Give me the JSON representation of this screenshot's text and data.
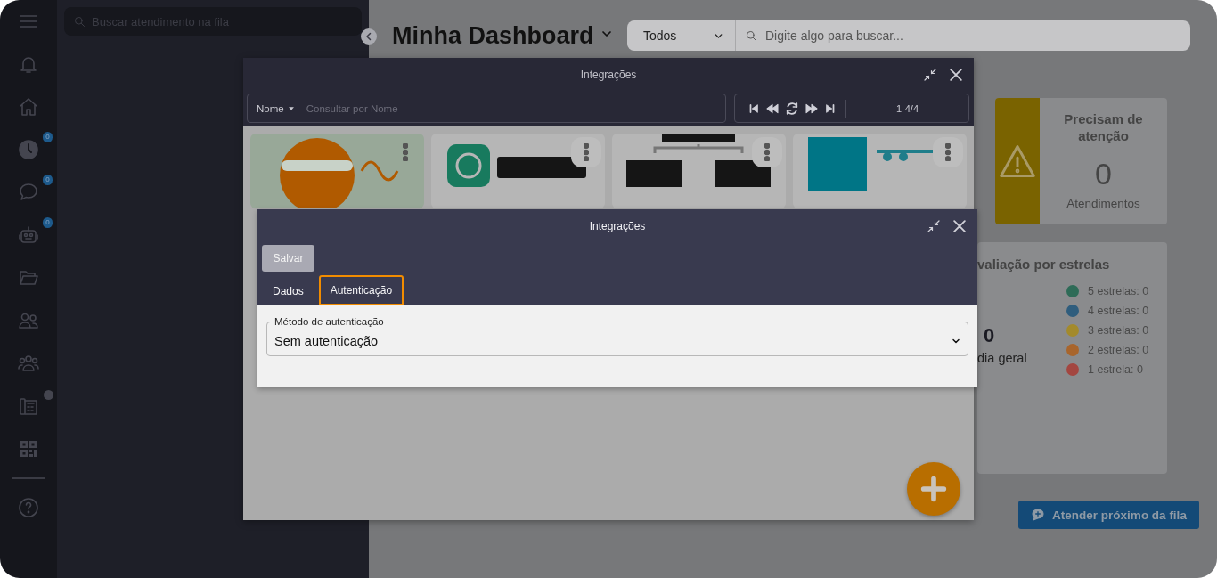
{
  "rail": {
    "items": [
      {
        "kind": "menu",
        "indicator": false
      },
      {
        "kind": "bell",
        "indicator": false
      },
      {
        "kind": "home",
        "indicator": false
      },
      {
        "kind": "clock",
        "badge": "0",
        "indicator": false
      },
      {
        "kind": "chat",
        "badge": "0",
        "indicator": false
      },
      {
        "kind": "robot",
        "badge": "0",
        "indicator": false
      },
      {
        "kind": "folder",
        "indicator": false
      },
      {
        "kind": "users",
        "indicator": false
      },
      {
        "kind": "group",
        "indicator": false
      },
      {
        "kind": "phone",
        "indicator": true
      },
      {
        "kind": "qr",
        "indicator": false
      },
      {
        "kind": "help",
        "indicator": false
      }
    ]
  },
  "queue": {
    "search": {
      "placeholder": "Buscar atendimento na fila"
    }
  },
  "dashboard": {
    "title": "Minha Dashboard",
    "filter": {
      "value": "Todos"
    },
    "search": {
      "placeholder": "Digite algo para buscar..."
    },
    "attention_card": {
      "title": "Precisam de atenção",
      "count": "0",
      "caption": "Atendimentos"
    },
    "stars_card": {
      "title": "valiação por estrelas",
      "average": "0",
      "average_label": "dia geral",
      "legend": [
        {
          "label": "5 estrelas: 0",
          "color": "#2e6b57"
        },
        {
          "label": "4 estrelas: 0",
          "color": "#2f5d7d"
        },
        {
          "label": "3 estrelas: 0",
          "color": "#a38a2c"
        },
        {
          "label": "2 estrelas: 0",
          "color": "#a8652c"
        },
        {
          "label": "1 estrela: 0",
          "color": "#a34640"
        }
      ]
    },
    "next_button": {
      "label": "Atender próximo da fila"
    }
  },
  "integrations_window": {
    "title": "Integrações",
    "search": {
      "field": "Nome",
      "placeholder": "Consultar por Nome"
    },
    "pager": {
      "range": "1-4/4"
    }
  },
  "edit_window": {
    "title": "Integrações",
    "save_button": "Salvar",
    "tabs": [
      {
        "label": "Dados",
        "selected": false
      },
      {
        "label": "Autenticação",
        "selected": true
      }
    ],
    "auth_method": {
      "label": "Método de autenticação",
      "value": "Sem autenticação"
    }
  }
}
